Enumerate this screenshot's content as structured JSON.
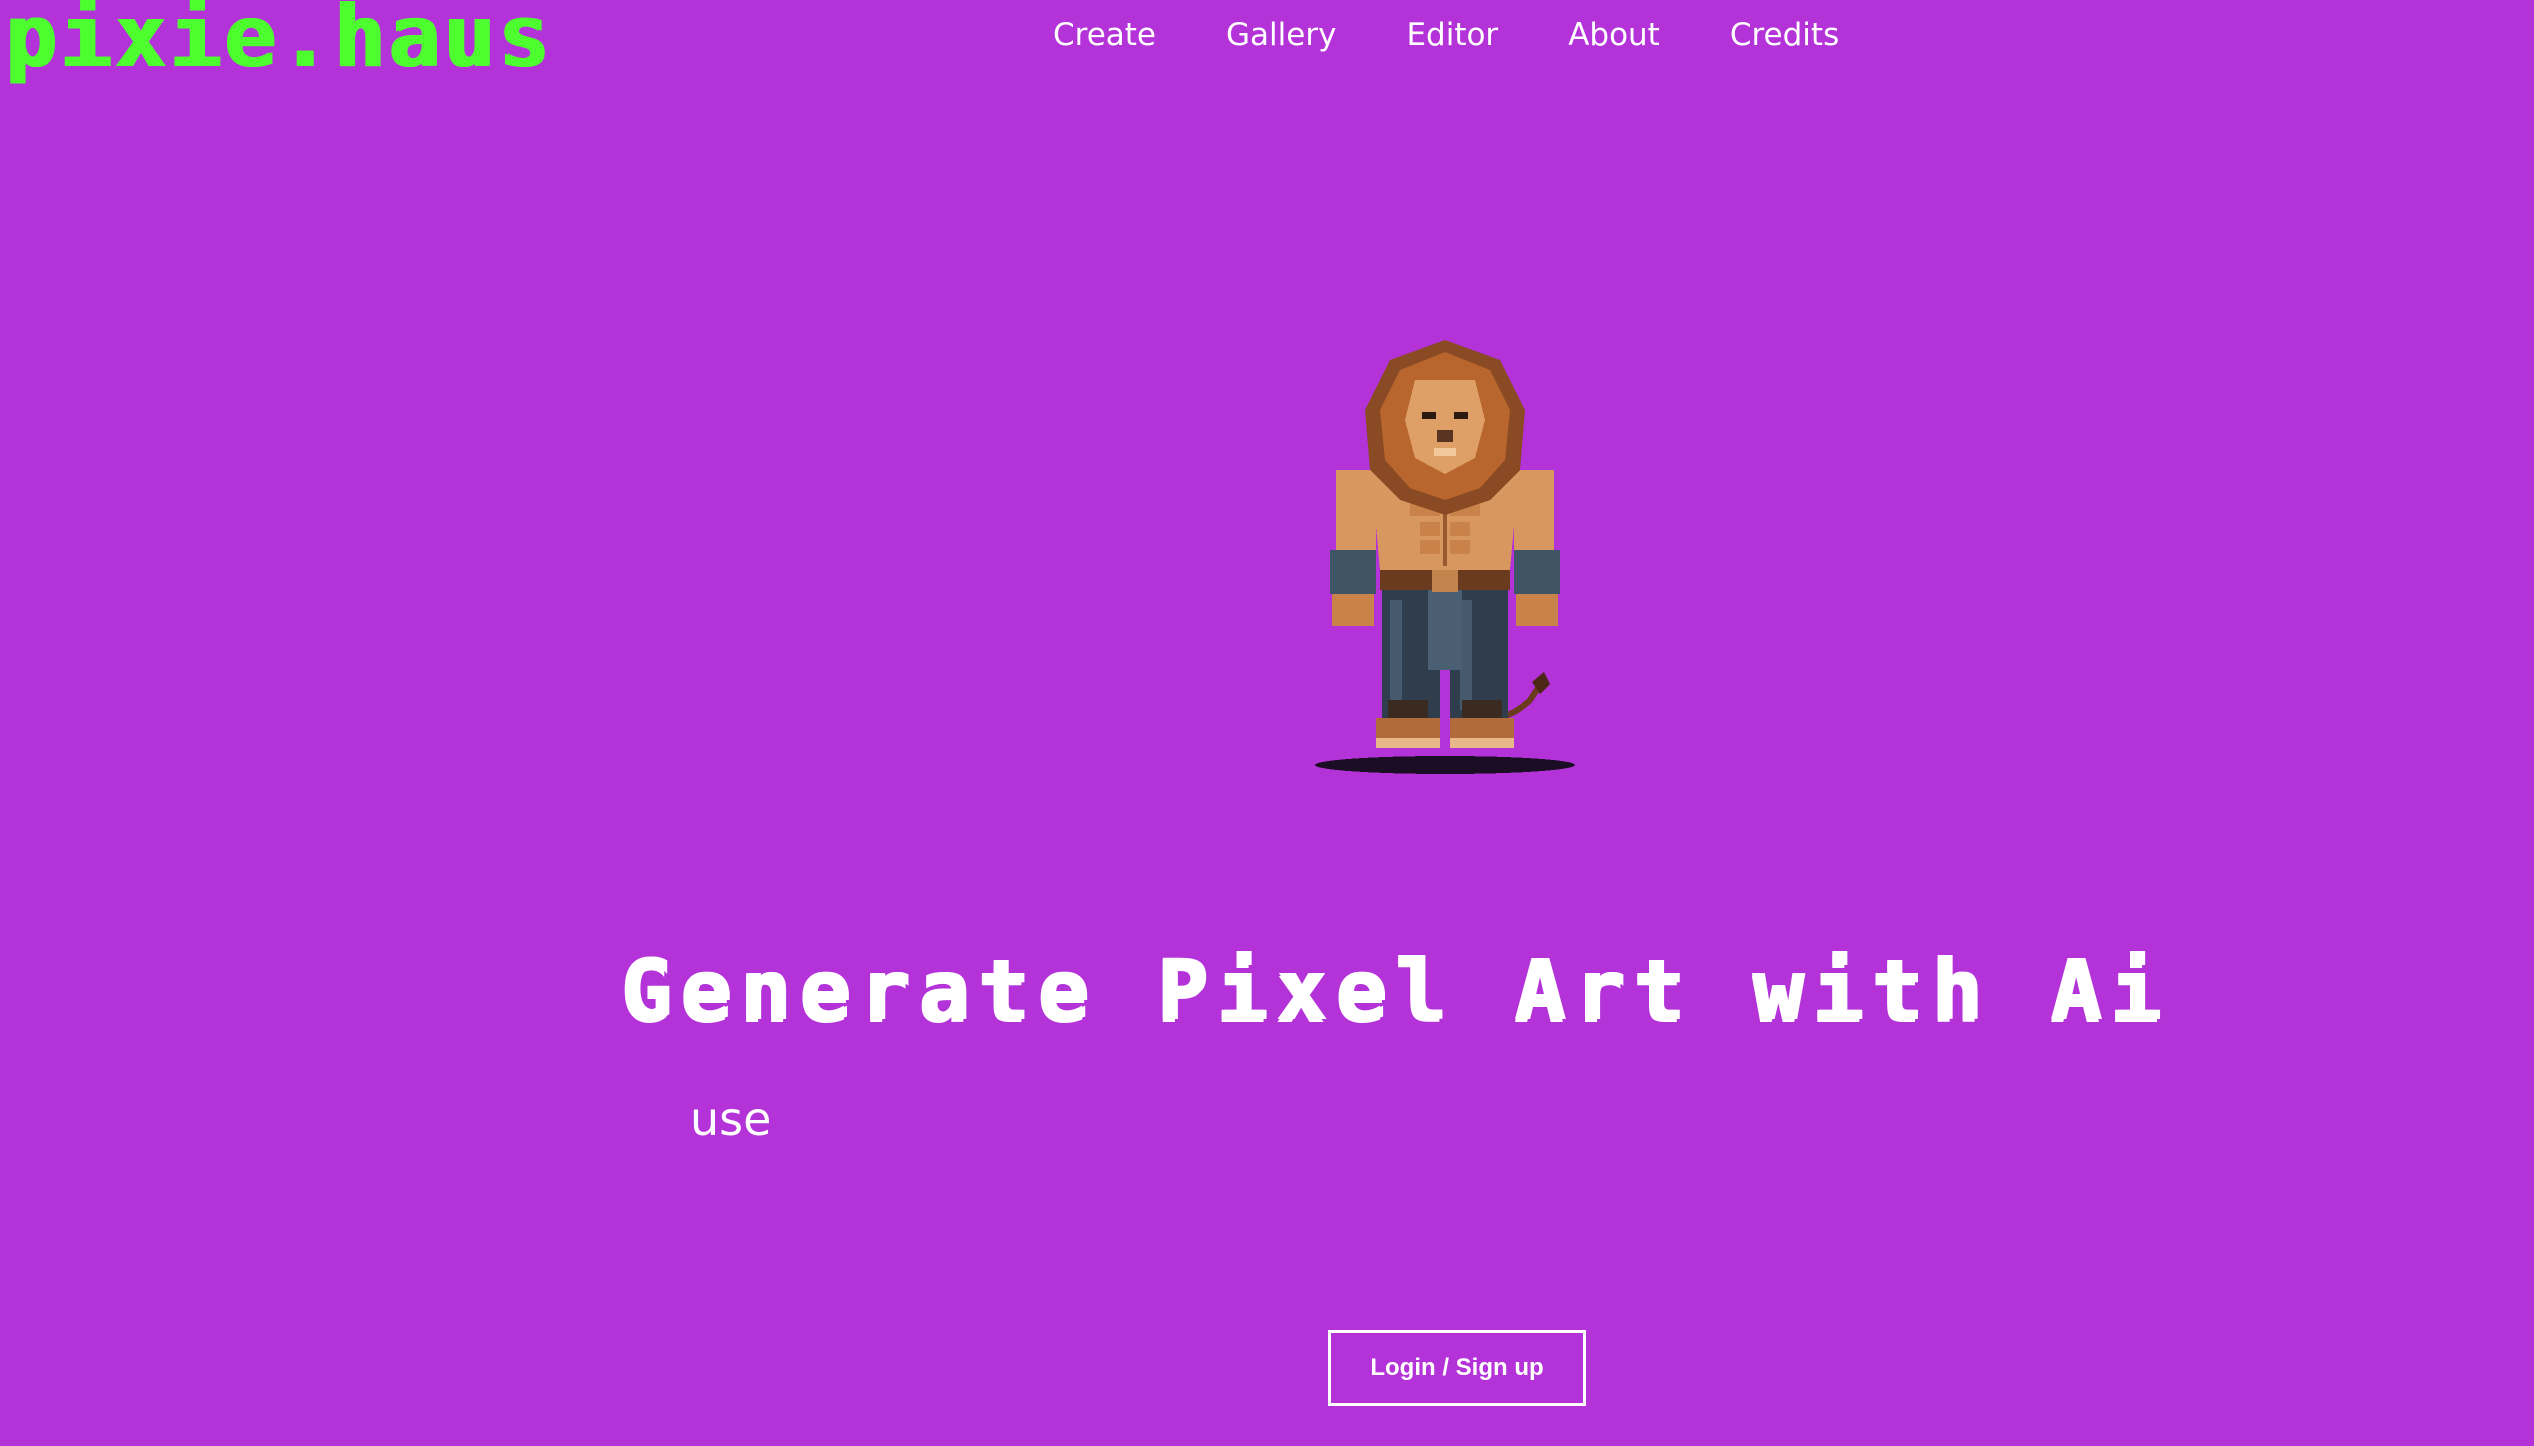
{
  "brand": {
    "logo_text": "pixie.haus"
  },
  "nav": {
    "items": [
      {
        "label": "Create"
      },
      {
        "label": "Gallery"
      },
      {
        "label": "Editor"
      },
      {
        "label": "About"
      },
      {
        "label": "Credits"
      }
    ]
  },
  "hero": {
    "image_icon": "lion-warrior-pixel-art",
    "headline": "Generate Pixel Art with Ai",
    "subline": "use",
    "login_label": "Login / Sign up"
  },
  "colors": {
    "background": "#b333d9",
    "logo": "#4dff2e",
    "text": "#ffffff"
  }
}
